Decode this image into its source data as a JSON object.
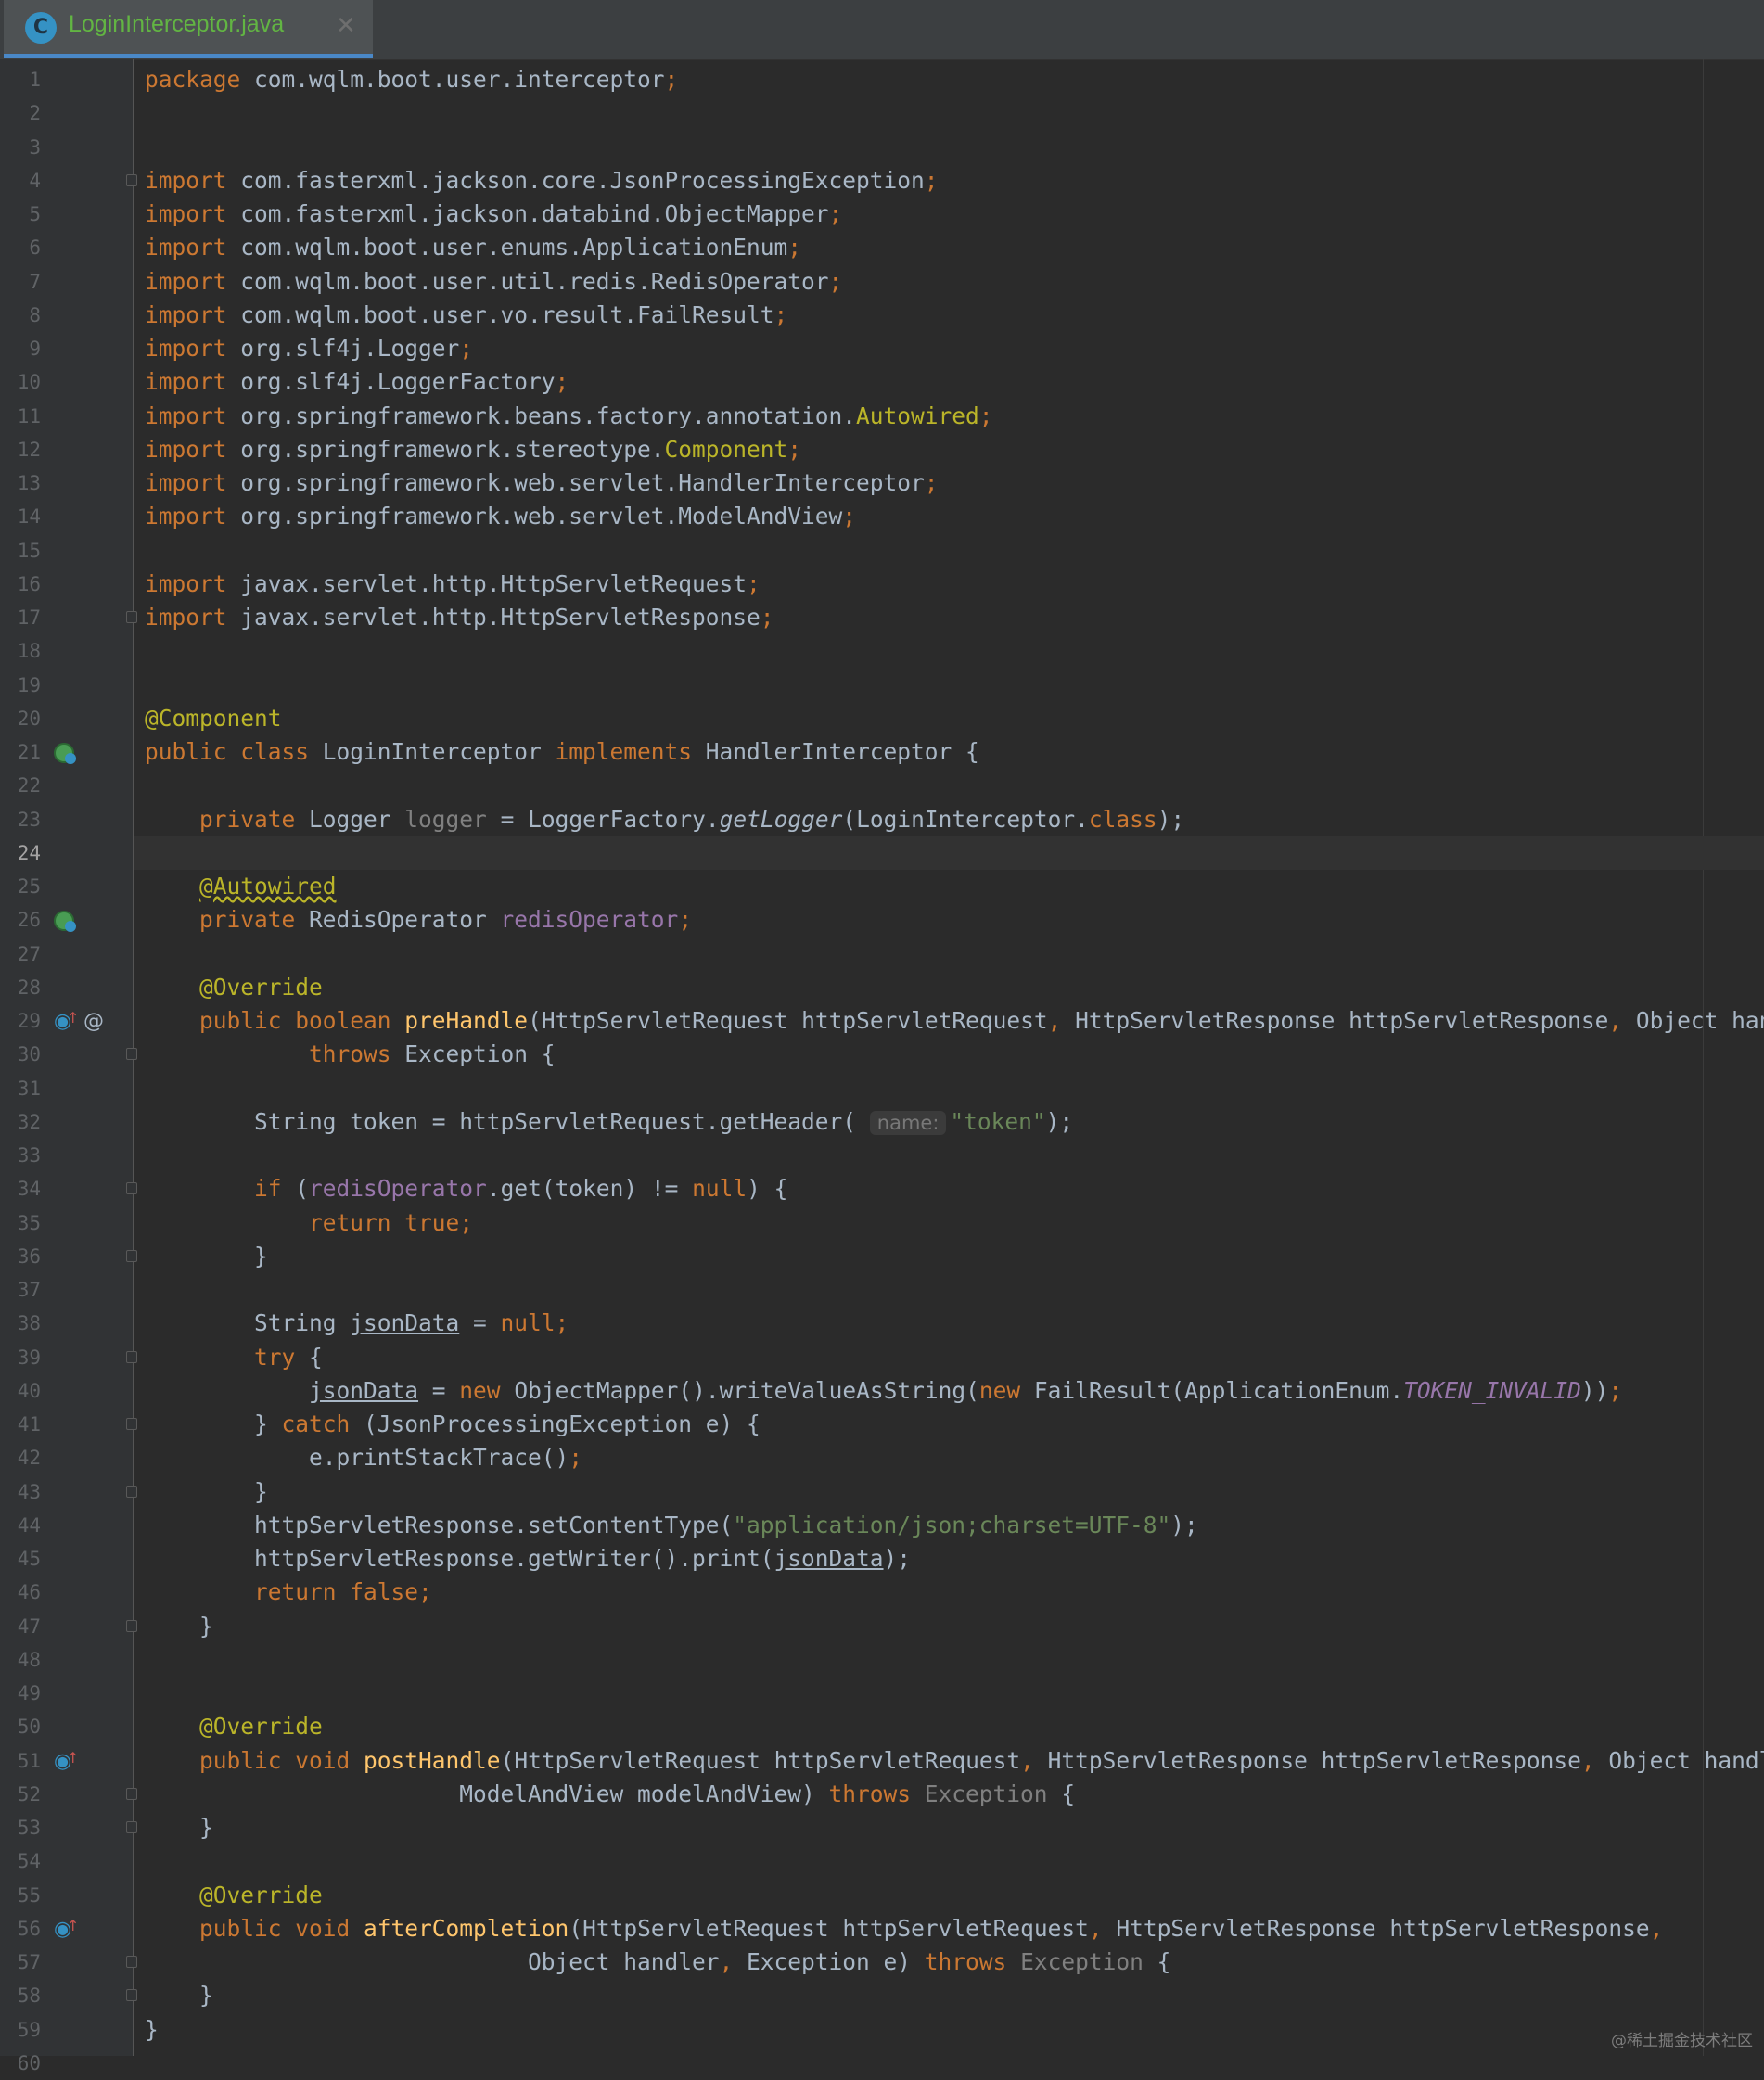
{
  "editor": {
    "tab": {
      "title": "LoginInterceptor.java",
      "icon": "java-class-icon",
      "close_glyph": "✕"
    },
    "current_line": 24,
    "colors": {
      "background": "#2b2b2b",
      "gutter": "#313335",
      "keyword": "#cc7832",
      "annotation": "#bbb529",
      "field": "#9876aa",
      "string": "#6a8759",
      "method_declaration": "#ffc66d",
      "default_text": "#a9b7c6",
      "line_number": "#606366"
    },
    "lines": [
      {
        "n": "1",
        "tokens": [
          [
            "package",
            "kw"
          ],
          [
            " com.wqlm.boot.user.interceptor",
            ""
          ],
          [
            ";",
            "kw"
          ]
        ]
      },
      {
        "n": "2",
        "tokens": []
      },
      {
        "n": "3",
        "tokens": []
      },
      {
        "n": "4",
        "fold": true,
        "tokens": [
          [
            "import",
            "kw"
          ],
          [
            " com.fasterxml.jackson.core.JsonProcessingException",
            ""
          ],
          [
            ";",
            "kw"
          ]
        ]
      },
      {
        "n": "5",
        "tokens": [
          [
            "import",
            "kw"
          ],
          [
            " com.fasterxml.jackson.databind.ObjectMapper",
            ""
          ],
          [
            ";",
            "kw"
          ]
        ]
      },
      {
        "n": "6",
        "tokens": [
          [
            "import",
            "kw"
          ],
          [
            " com.wqlm.boot.user.enums.ApplicationEnum",
            ""
          ],
          [
            ";",
            "kw"
          ]
        ]
      },
      {
        "n": "7",
        "tokens": [
          [
            "import",
            "kw"
          ],
          [
            " com.wqlm.boot.user.util.redis.RedisOperator",
            ""
          ],
          [
            ";",
            "kw"
          ]
        ]
      },
      {
        "n": "8",
        "tokens": [
          [
            "import",
            "kw"
          ],
          [
            " com.wqlm.boot.user.vo.result.FailResult",
            ""
          ],
          [
            ";",
            "kw"
          ]
        ]
      },
      {
        "n": "9",
        "tokens": [
          [
            "import",
            "kw"
          ],
          [
            " org.slf4j.Logger",
            ""
          ],
          [
            ";",
            "kw"
          ]
        ]
      },
      {
        "n": "10",
        "tokens": [
          [
            "import",
            "kw"
          ],
          [
            " org.slf4j.LoggerFactory",
            ""
          ],
          [
            ";",
            "kw"
          ]
        ]
      },
      {
        "n": "11",
        "tokens": [
          [
            "import",
            "kw"
          ],
          [
            " org.springframework.beans.factory.annotation.",
            ""
          ],
          [
            "Autowired",
            "ann"
          ],
          [
            ";",
            "kw"
          ]
        ]
      },
      {
        "n": "12",
        "tokens": [
          [
            "import",
            "kw"
          ],
          [
            " org.springframework.stereotype.",
            ""
          ],
          [
            "Component",
            "ann"
          ],
          [
            ";",
            "kw"
          ]
        ]
      },
      {
        "n": "13",
        "tokens": [
          [
            "import",
            "kw"
          ],
          [
            " org.springframework.web.servlet.HandlerInterceptor",
            ""
          ],
          [
            ";",
            "kw"
          ]
        ]
      },
      {
        "n": "14",
        "tokens": [
          [
            "import",
            "kw"
          ],
          [
            " org.springframework.web.servlet.ModelAndView",
            ""
          ],
          [
            ";",
            "kw"
          ]
        ]
      },
      {
        "n": "15",
        "tokens": []
      },
      {
        "n": "16",
        "tokens": [
          [
            "import",
            "kw"
          ],
          [
            " javax.servlet.http.HttpServletRequest",
            ""
          ],
          [
            ";",
            "kw"
          ]
        ]
      },
      {
        "n": "17",
        "fold": true,
        "tokens": [
          [
            "import",
            "kw"
          ],
          [
            " javax.servlet.http.HttpServletResponse",
            ""
          ],
          [
            ";",
            "kw"
          ]
        ]
      },
      {
        "n": "18",
        "tokens": []
      },
      {
        "n": "19",
        "tokens": []
      },
      {
        "n": "20",
        "tokens": [
          [
            "@Component",
            "ann"
          ]
        ]
      },
      {
        "n": "21",
        "gutter_icon": "spring-bean-icon",
        "tokens": [
          [
            "public class",
            "kw"
          ],
          [
            " LoginInterceptor ",
            ""
          ],
          [
            "implements",
            "kw"
          ],
          [
            " HandlerInterceptor {",
            ""
          ]
        ]
      },
      {
        "n": "22",
        "tokens": []
      },
      {
        "n": "23",
        "tokens": [
          [
            "    ",
            ""
          ],
          [
            "private",
            "kw"
          ],
          [
            " Logger ",
            ""
          ],
          [
            "logger",
            "gray"
          ],
          [
            " = LoggerFactory.",
            ""
          ],
          [
            "getLogger",
            "it"
          ],
          [
            "(LoginInterceptor.",
            ""
          ],
          [
            "class",
            "kw"
          ],
          [
            ");",
            ""
          ]
        ]
      },
      {
        "n": "24",
        "tokens": []
      },
      {
        "n": "25",
        "tokens": [
          [
            "    ",
            ""
          ],
          [
            "@Autowired",
            "ann wavy"
          ]
        ]
      },
      {
        "n": "26",
        "gutter_icon": "spring-bean-icon",
        "tokens": [
          [
            "    ",
            ""
          ],
          [
            "private",
            "kw"
          ],
          [
            " RedisOperator ",
            ""
          ],
          [
            "redisOperator",
            "fld"
          ],
          [
            ";",
            "kw"
          ]
        ]
      },
      {
        "n": "27",
        "tokens": []
      },
      {
        "n": "28",
        "tokens": [
          [
            "    ",
            ""
          ],
          [
            "@Override",
            "ann"
          ]
        ]
      },
      {
        "n": "29",
        "gutter_icon": "override-icon",
        "at_icon": "@",
        "tokens": [
          [
            "    ",
            ""
          ],
          [
            "public boolean",
            "kw"
          ],
          [
            " ",
            ""
          ],
          [
            "preHandle",
            "fn"
          ],
          [
            "(HttpServletRequest httpServletRequest",
            ""
          ],
          [
            ",",
            "kw"
          ],
          [
            " HttpServletResponse httpServletResponse",
            ""
          ],
          [
            ",",
            "kw"
          ],
          [
            " Object handler)",
            ""
          ]
        ]
      },
      {
        "n": "30",
        "fold": true,
        "tokens": [
          [
            "            ",
            ""
          ],
          [
            "throws",
            "kw"
          ],
          [
            " Exception {",
            ""
          ]
        ]
      },
      {
        "n": "31",
        "tokens": []
      },
      {
        "n": "32",
        "tokens": [
          [
            "        String token = httpServletRequest.getHeader( ",
            ""
          ],
          [
            "name:",
            "hint"
          ],
          [
            "\"token\"",
            "str"
          ],
          [
            ");",
            ""
          ]
        ]
      },
      {
        "n": "33",
        "tokens": []
      },
      {
        "n": "34",
        "fold": true,
        "tokens": [
          [
            "        ",
            ""
          ],
          [
            "if",
            "kw"
          ],
          [
            " (",
            ""
          ],
          [
            "redisOperator",
            "fld"
          ],
          [
            ".get(token) != ",
            ""
          ],
          [
            "null",
            "kw"
          ],
          [
            ") {",
            ""
          ]
        ]
      },
      {
        "n": "35",
        "tokens": [
          [
            "            ",
            ""
          ],
          [
            "return true;",
            "kw"
          ]
        ]
      },
      {
        "n": "36",
        "fold": true,
        "tokens": [
          [
            "        }",
            ""
          ]
        ]
      },
      {
        "n": "37",
        "tokens": []
      },
      {
        "n": "38",
        "tokens": [
          [
            "        String ",
            ""
          ],
          [
            "jsonData",
            "ul"
          ],
          [
            " = ",
            ""
          ],
          [
            "null;",
            "kw"
          ]
        ]
      },
      {
        "n": "39",
        "fold": true,
        "tokens": [
          [
            "        ",
            ""
          ],
          [
            "try",
            "kw"
          ],
          [
            " {",
            ""
          ]
        ]
      },
      {
        "n": "40",
        "tokens": [
          [
            "            ",
            ""
          ],
          [
            "jsonData",
            "ul"
          ],
          [
            " = ",
            ""
          ],
          [
            "new",
            "kw"
          ],
          [
            " ObjectMapper().writeValueAsString(",
            ""
          ],
          [
            "new",
            "kw"
          ],
          [
            " FailResult(ApplicationEnum.",
            ""
          ],
          [
            "TOKEN_INVALID",
            "cst"
          ],
          [
            "))",
            ""
          ],
          [
            ";",
            "kw"
          ]
        ]
      },
      {
        "n": "41",
        "fold": true,
        "tokens": [
          [
            "        } ",
            ""
          ],
          [
            "catch",
            "kw"
          ],
          [
            " (JsonProcessingException e) {",
            ""
          ]
        ]
      },
      {
        "n": "42",
        "tokens": [
          [
            "            e.printStackTrace()",
            ""
          ],
          [
            ";",
            "kw"
          ]
        ]
      },
      {
        "n": "43",
        "fold": true,
        "tokens": [
          [
            "        }",
            ""
          ]
        ]
      },
      {
        "n": "44",
        "tokens": [
          [
            "        httpServletResponse.setContentType(",
            ""
          ],
          [
            "\"application/json;charset=UTF-8\"",
            "str"
          ],
          [
            ");",
            ""
          ]
        ]
      },
      {
        "n": "45",
        "tokens": [
          [
            "        httpServletResponse.getWriter().print(",
            ""
          ],
          [
            "jsonData",
            "ul"
          ],
          [
            ");",
            ""
          ]
        ]
      },
      {
        "n": "46",
        "tokens": [
          [
            "        ",
            ""
          ],
          [
            "return false;",
            "kw"
          ]
        ]
      },
      {
        "n": "47",
        "fold": true,
        "tokens": [
          [
            "    }",
            ""
          ]
        ]
      },
      {
        "n": "48",
        "tokens": []
      },
      {
        "n": "49",
        "tokens": []
      },
      {
        "n": "50",
        "tokens": [
          [
            "    ",
            ""
          ],
          [
            "@Override",
            "ann"
          ]
        ]
      },
      {
        "n": "51",
        "gutter_icon": "override-icon",
        "tokens": [
          [
            "    ",
            ""
          ],
          [
            "public void",
            "kw"
          ],
          [
            " ",
            ""
          ],
          [
            "postHandle",
            "fn"
          ],
          [
            "(HttpServletRequest httpServletRequest",
            ""
          ],
          [
            ",",
            "kw"
          ],
          [
            " HttpServletResponse httpServletResponse",
            ""
          ],
          [
            ",",
            "kw"
          ],
          [
            " Object handler",
            ""
          ],
          [
            ",",
            "kw"
          ]
        ]
      },
      {
        "n": "52",
        "fold": true,
        "tokens": [
          [
            "                       ModelAndView modelAndView) ",
            ""
          ],
          [
            "throws",
            "kw"
          ],
          [
            " ",
            ""
          ],
          [
            "Exception",
            "gray"
          ],
          [
            " {",
            ""
          ]
        ]
      },
      {
        "n": "53",
        "fold": true,
        "tokens": [
          [
            "    }",
            ""
          ]
        ]
      },
      {
        "n": "54",
        "tokens": []
      },
      {
        "n": "55",
        "tokens": [
          [
            "    ",
            ""
          ],
          [
            "@Override",
            "ann"
          ]
        ]
      },
      {
        "n": "56",
        "gutter_icon": "override-icon",
        "tokens": [
          [
            "    ",
            ""
          ],
          [
            "public void",
            "kw"
          ],
          [
            " ",
            ""
          ],
          [
            "afterCompletion",
            "fn"
          ],
          [
            "(HttpServletRequest httpServletRequest",
            ""
          ],
          [
            ",",
            "kw"
          ],
          [
            " HttpServletResponse httpServletResponse",
            ""
          ],
          [
            ",",
            "kw"
          ]
        ]
      },
      {
        "n": "57",
        "fold": true,
        "tokens": [
          [
            "                            Object handler",
            ""
          ],
          [
            ",",
            "kw"
          ],
          [
            " Exception e) ",
            ""
          ],
          [
            "throws",
            "kw"
          ],
          [
            " ",
            ""
          ],
          [
            "Exception",
            "gray"
          ],
          [
            " {",
            ""
          ]
        ]
      },
      {
        "n": "58",
        "fold": true,
        "tokens": [
          [
            "    }",
            ""
          ]
        ]
      },
      {
        "n": "59",
        "tokens": [
          [
            "}",
            ""
          ]
        ]
      },
      {
        "n": "60",
        "tokens": []
      }
    ]
  },
  "watermark": "@稀土掘金技术社区"
}
